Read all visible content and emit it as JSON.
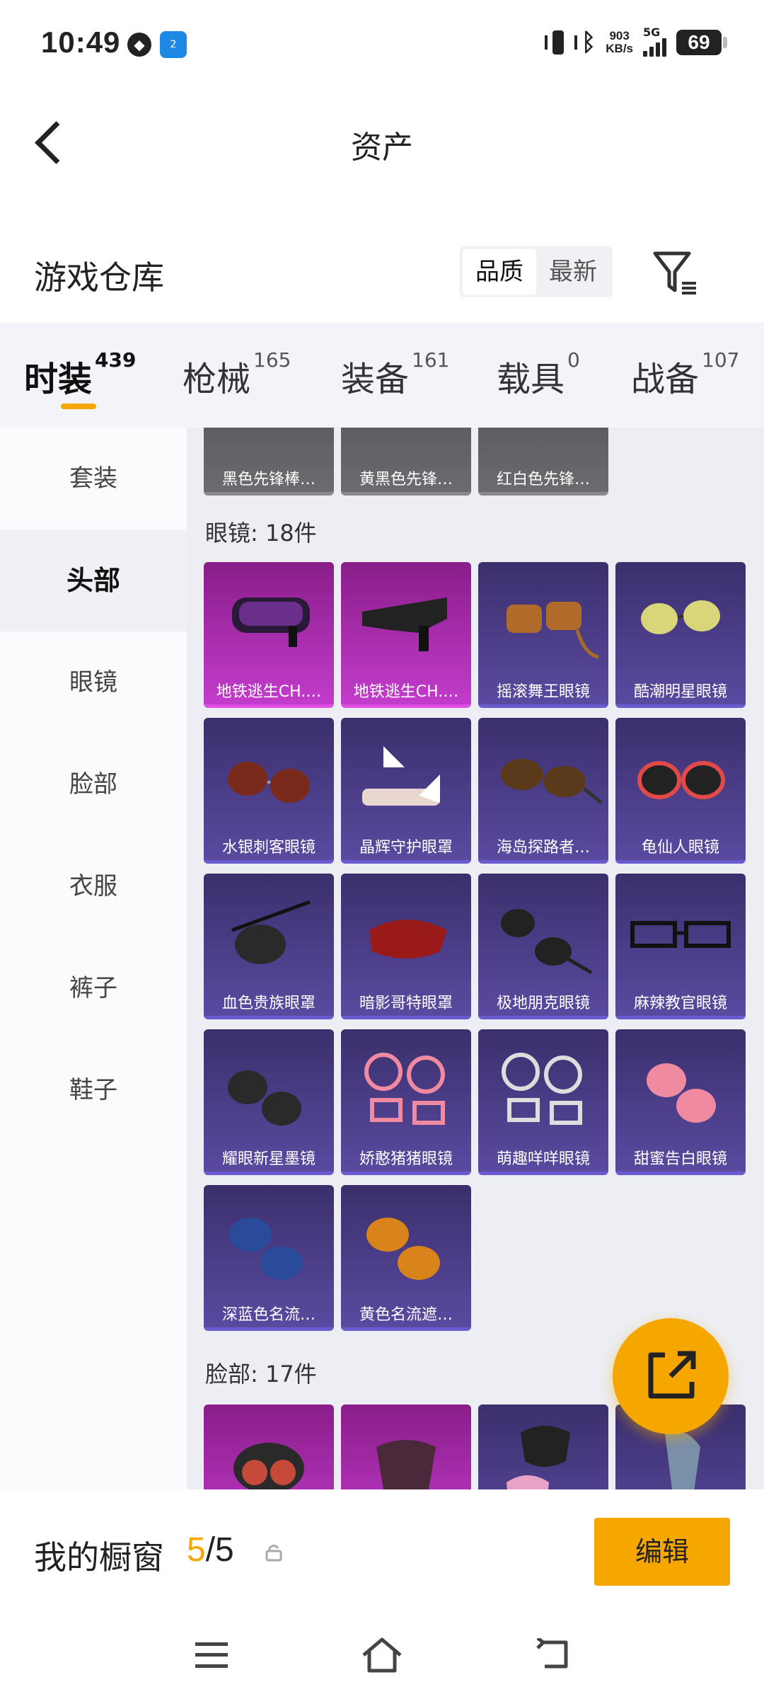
{
  "status_bar": {
    "time": "10:49",
    "icon_small_label": "2",
    "speed_top": "903",
    "speed_bottom": "KB/s",
    "network": "5G",
    "battery": "69"
  },
  "header": {
    "title": "资产"
  },
  "warehouse": {
    "title": "游戏仓库",
    "sort_options": [
      {
        "label": "品质",
        "active": true
      },
      {
        "label": "最新",
        "active": false
      }
    ]
  },
  "category_tabs": [
    {
      "label": "时装",
      "count": "439",
      "active": true
    },
    {
      "label": "枪械",
      "count": "165",
      "active": false
    },
    {
      "label": "装备",
      "count": "161",
      "active": false
    },
    {
      "label": "载具",
      "count": "0",
      "active": false
    },
    {
      "label": "战备",
      "count": "107",
      "active": false
    }
  ],
  "sidebar": {
    "items": [
      {
        "label": "套装",
        "active": false
      },
      {
        "label": "头部",
        "active": true
      },
      {
        "label": "眼镜",
        "active": false
      },
      {
        "label": "脸部",
        "active": false
      },
      {
        "label": "衣服",
        "active": false
      },
      {
        "label": "裤子",
        "active": false
      },
      {
        "label": "鞋子",
        "active": false
      }
    ]
  },
  "top_partial_items": [
    "黑色先锋棒…",
    "黄黑色先锋…",
    "红白色先锋…"
  ],
  "glasses_section": {
    "title": "眼镜: 18件",
    "items": [
      {
        "name": "地铁逃生CH.…",
        "rarity": "pink"
      },
      {
        "name": "地铁逃生CH.…",
        "rarity": "pink"
      },
      {
        "name": "摇滚舞王眼镜",
        "rarity": "purple"
      },
      {
        "name": "酷潮明星眼镜",
        "rarity": "purple"
      },
      {
        "name": "水银刺客眼镜",
        "rarity": "purple"
      },
      {
        "name": "晶辉守护眼罩",
        "rarity": "purple"
      },
      {
        "name": "海岛探路者…",
        "rarity": "purple"
      },
      {
        "name": "龟仙人眼镜",
        "rarity": "purple"
      },
      {
        "name": "血色贵族眼罩",
        "rarity": "purple"
      },
      {
        "name": "暗影哥特眼罩",
        "rarity": "purple"
      },
      {
        "name": "极地朋克眼镜",
        "rarity": "purple"
      },
      {
        "name": "麻辣教官眼镜",
        "rarity": "purple"
      },
      {
        "name": "耀眼新星墨镜",
        "rarity": "purple"
      },
      {
        "name": "娇憨猪猪眼镜",
        "rarity": "purple"
      },
      {
        "name": "萌趣咩咩眼镜",
        "rarity": "purple"
      },
      {
        "name": "甜蜜告白眼镜",
        "rarity": "purple"
      },
      {
        "name": "深蓝色名流…",
        "rarity": "purple"
      },
      {
        "name": "黄色名流遮…",
        "rarity": "purple"
      }
    ]
  },
  "face_section": {
    "title": "脸部: 17件"
  },
  "bottom": {
    "window_label": "我的橱窗",
    "count_current": "5",
    "count_sep": "/",
    "count_total": "5",
    "edit_label": "编辑"
  },
  "colors": {
    "accent": "#f5a700",
    "card_purple": "#4a3c8a",
    "card_pink": "#b02db5"
  }
}
